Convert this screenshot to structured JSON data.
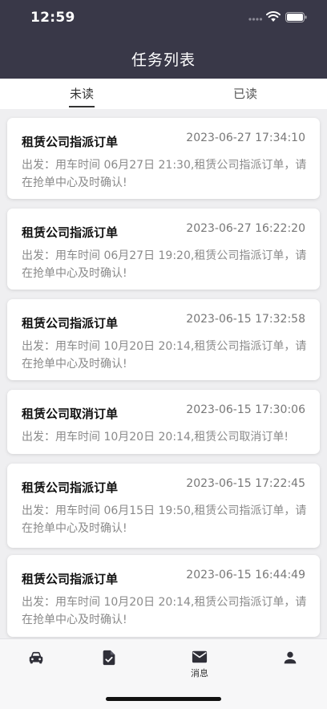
{
  "status_bar": {
    "time": "12:59"
  },
  "header": {
    "title": "任务列表"
  },
  "tabs": [
    {
      "label": "未读",
      "active": true
    },
    {
      "label": "已读",
      "active": false
    }
  ],
  "tasks": [
    {
      "title": "租赁公司指派订单",
      "time": "2023-06-27 17:34:10",
      "body": "出发：用车时间 06月27日 21:30,租赁公司指派订单，请在抢单中心及时确认!"
    },
    {
      "title": "租赁公司指派订单",
      "time": "2023-06-27 16:22:20",
      "body": "出发：用车时间 06月27日 19:20,租赁公司指派订单，请在抢单中心及时确认!"
    },
    {
      "title": "租赁公司指派订单",
      "time": "2023-06-15 17:32:58",
      "body": "出发：用车时间 10月20日 20:14,租赁公司指派订单，请在抢单中心及时确认!"
    },
    {
      "title": "租赁公司取消订单",
      "time": "2023-06-15 17:30:06",
      "body": "出发：用车时间 10月20日 20:14,租赁公司取消订单!"
    },
    {
      "title": "租赁公司指派订单",
      "time": "2023-06-15 17:22:45",
      "body": "出发：用车时间 06月15日 19:50,租赁公司指派订单，请在抢单中心及时确认!"
    },
    {
      "title": "租赁公司指派订单",
      "time": "2023-06-15 16:44:49",
      "body": "出发：用车时间 10月20日 20:14,租赁公司指派订单，请在抢单中心及时确认!"
    }
  ],
  "tabbar": {
    "items": [
      {
        "icon": "car-icon",
        "label": ""
      },
      {
        "icon": "document-check-icon",
        "label": ""
      },
      {
        "icon": "mail-icon",
        "label": "消息"
      },
      {
        "icon": "person-icon",
        "label": ""
      }
    ]
  },
  "colors": {
    "header_bg": "#393848",
    "page_bg": "#efeff1"
  }
}
